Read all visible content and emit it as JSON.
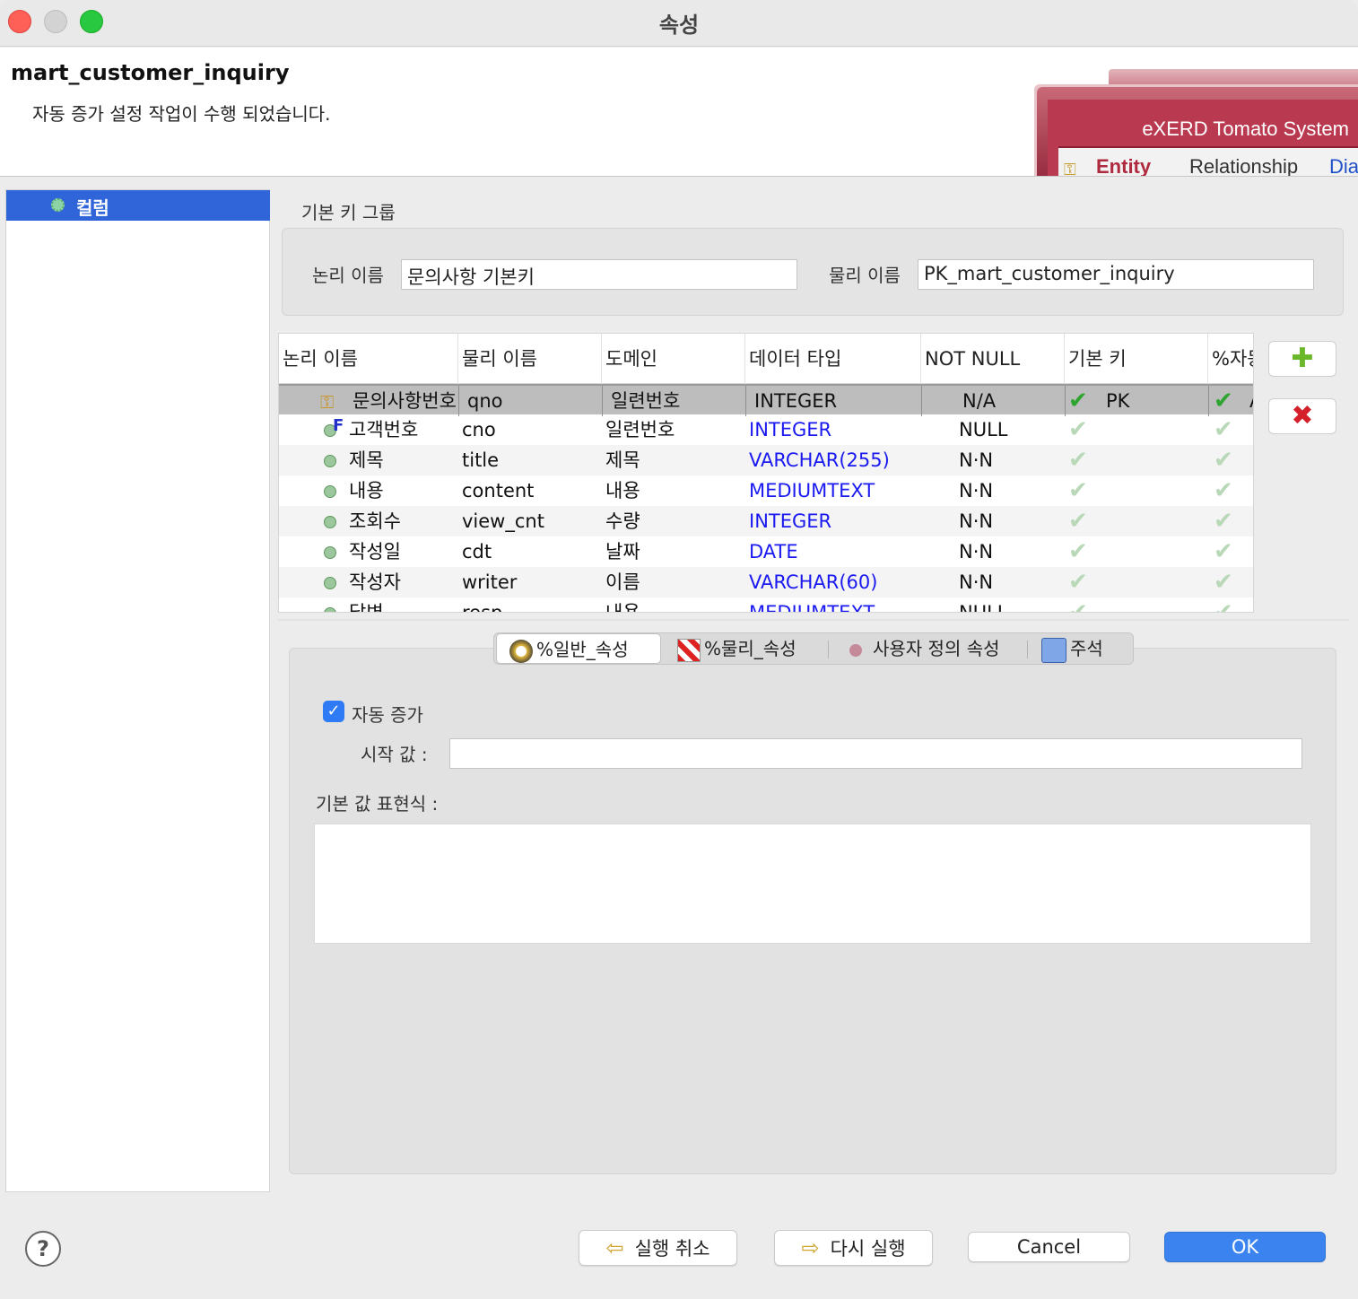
{
  "window": {
    "title": "속성"
  },
  "header": {
    "title": "mart_customer_inquiry",
    "message": "자동 증가 설정 작업이 수행 되었습니다.",
    "banner_brand": "eXERD  Tomato System",
    "banner_tabs": [
      "Entity",
      "Relationship",
      "Diag"
    ]
  },
  "sidebar": {
    "items": [
      {
        "label": "컬럼"
      }
    ]
  },
  "pk_group": {
    "label": "기본 키 그룹",
    "logical_label": "논리 이름",
    "logical_value": "문의사항 기본키",
    "physical_label": "물리 이름",
    "physical_value": "PK_mart_customer_inquiry"
  },
  "table": {
    "columns": [
      "논리 이름",
      "물리 이름",
      "도메인",
      "데이터 타입",
      "NOT NULL",
      "기본 키",
      "%자동"
    ],
    "rows": [
      {
        "logical": "문의사항번호",
        "physical": "qno",
        "domain": "일련번호",
        "type": "INTEGER",
        "notnull": "N/A",
        "pk": true,
        "pk_text": "PK",
        "auto": true,
        "auto_text": "A",
        "kind": "pk"
      },
      {
        "logical": "고객번호",
        "physical": "cno",
        "domain": "일련번호",
        "type": "INTEGER",
        "notnull": "NULL",
        "pk": false,
        "pk_text": "",
        "auto": false,
        "auto_text": "",
        "kind": "fk"
      },
      {
        "logical": "제목",
        "physical": "title",
        "domain": "제목",
        "type": "VARCHAR(255)",
        "notnull": "N·N",
        "pk": false,
        "pk_text": "",
        "auto": false,
        "auto_text": "",
        "kind": "col"
      },
      {
        "logical": "내용",
        "physical": "content",
        "domain": "내용",
        "type": "MEDIUMTEXT",
        "notnull": "N·N",
        "pk": false,
        "pk_text": "",
        "auto": false,
        "auto_text": "",
        "kind": "col"
      },
      {
        "logical": "조회수",
        "physical": "view_cnt",
        "domain": "수량",
        "type": "INTEGER",
        "notnull": "N·N",
        "pk": false,
        "pk_text": "",
        "auto": false,
        "auto_text": "",
        "kind": "col"
      },
      {
        "logical": "작성일",
        "physical": "cdt",
        "domain": "날짜",
        "type": "DATE",
        "notnull": "N·N",
        "pk": false,
        "pk_text": "",
        "auto": false,
        "auto_text": "",
        "kind": "col"
      },
      {
        "logical": "작성자",
        "physical": "writer",
        "domain": "이름",
        "type": "VARCHAR(60)",
        "notnull": "N·N",
        "pk": false,
        "pk_text": "",
        "auto": false,
        "auto_text": "",
        "kind": "col"
      },
      {
        "logical": "답변",
        "physical": "resp",
        "domain": "내용",
        "type": "MEDIUMTEXT",
        "notnull": "NULL",
        "pk": false,
        "pk_text": "",
        "auto": false,
        "auto_text": "",
        "kind": "col"
      }
    ]
  },
  "tabs": [
    "%일반_속성",
    "%물리_속성",
    "사용자 정의 속성",
    "주석"
  ],
  "general": {
    "auto_increment_label": "자동 증가",
    "auto_increment_checked": true,
    "start_label": "시작 값 :",
    "start_value": "",
    "default_expr_label": "기본 값 표현식 :",
    "default_expr_value": ""
  },
  "buttons": {
    "undo": "실행 취소",
    "redo": "다시 실행",
    "cancel": "Cancel",
    "ok": "OK",
    "help": "?"
  },
  "colors": {
    "accent": "#2f65d9",
    "ok": "#3b84f0",
    "type_text": "#1a1af0"
  }
}
